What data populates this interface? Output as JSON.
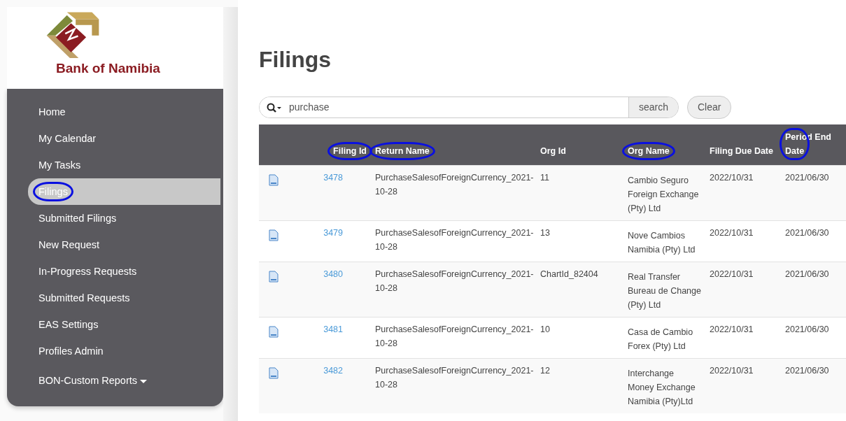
{
  "sidebar": {
    "brand": "Bank of Namibia",
    "items": [
      {
        "label": "Home",
        "selected": false,
        "circled": false
      },
      {
        "label": "My Calendar",
        "selected": false,
        "circled": false
      },
      {
        "label": "My Tasks",
        "selected": false,
        "circled": false
      },
      {
        "label": "Filings",
        "selected": true,
        "circled": true
      },
      {
        "label": "Submitted Filings",
        "selected": false,
        "circled": false
      },
      {
        "label": "New Request",
        "selected": false,
        "circled": false
      },
      {
        "label": "In-Progress Requests",
        "selected": false,
        "circled": false
      },
      {
        "label": "Submitted Requests",
        "selected": false,
        "circled": false
      },
      {
        "label": "EAS Settings",
        "selected": false,
        "circled": false
      },
      {
        "label": "Profiles Admin",
        "selected": false,
        "circled": false
      },
      {
        "label": "BON-Custom Reports",
        "selected": false,
        "circled": false,
        "kind": "dropdown"
      }
    ]
  },
  "page_title": "Filings",
  "search": {
    "value": "purchase",
    "button": "search",
    "clear": "Clear"
  },
  "table": {
    "columns": [
      {
        "label": "Filing Id",
        "circled": true
      },
      {
        "label": "Return Name",
        "circled": true
      },
      {
        "label": "Org Id",
        "circled": false
      },
      {
        "label": "Org Name",
        "circled": true
      },
      {
        "label": "Filing Due Date",
        "circled": false
      },
      {
        "label": "Period End Date",
        "circled": true
      }
    ],
    "rows": [
      {
        "filing_id": "3478",
        "return_name": "PurchaseSalesofForeignCurrency_2021-10-28",
        "org_id": "11",
        "org_name": "Cambio Seguro Foreign Exchange (Pty) Ltd",
        "filing_due_date": "2022/10/31",
        "period_end_date": "2021/06/30"
      },
      {
        "filing_id": "3479",
        "return_name": "PurchaseSalesofForeignCurrency_2021-10-28",
        "org_id": "13",
        "org_name": "Nove Cambios Namibia (Pty) Ltd",
        "filing_due_date": "2022/10/31",
        "period_end_date": "2021/06/30"
      },
      {
        "filing_id": "3480",
        "return_name": "PurchaseSalesofForeignCurrency_2021-10-28",
        "org_id": "ChartId_82404",
        "org_name": "Real Transfer Bureau de Change (Pty) Ltd",
        "filing_due_date": "2022/10/31",
        "period_end_date": "2021/06/30"
      },
      {
        "filing_id": "3481",
        "return_name": "PurchaseSalesofForeignCurrency_2021-10-28",
        "org_id": "10",
        "org_name": "Casa de Cambio Forex (Pty) Ltd",
        "filing_due_date": "2022/10/31",
        "period_end_date": "2021/06/30"
      },
      {
        "filing_id": "3482",
        "return_name": "PurchaseSalesofForeignCurrency_2021-10-28",
        "org_id": "12",
        "org_name": "Interchange Money Exchange Namibia (Pty)Ltd",
        "filing_due_date": "2022/10/31",
        "period_end_date": "2021/06/30"
      }
    ]
  }
}
